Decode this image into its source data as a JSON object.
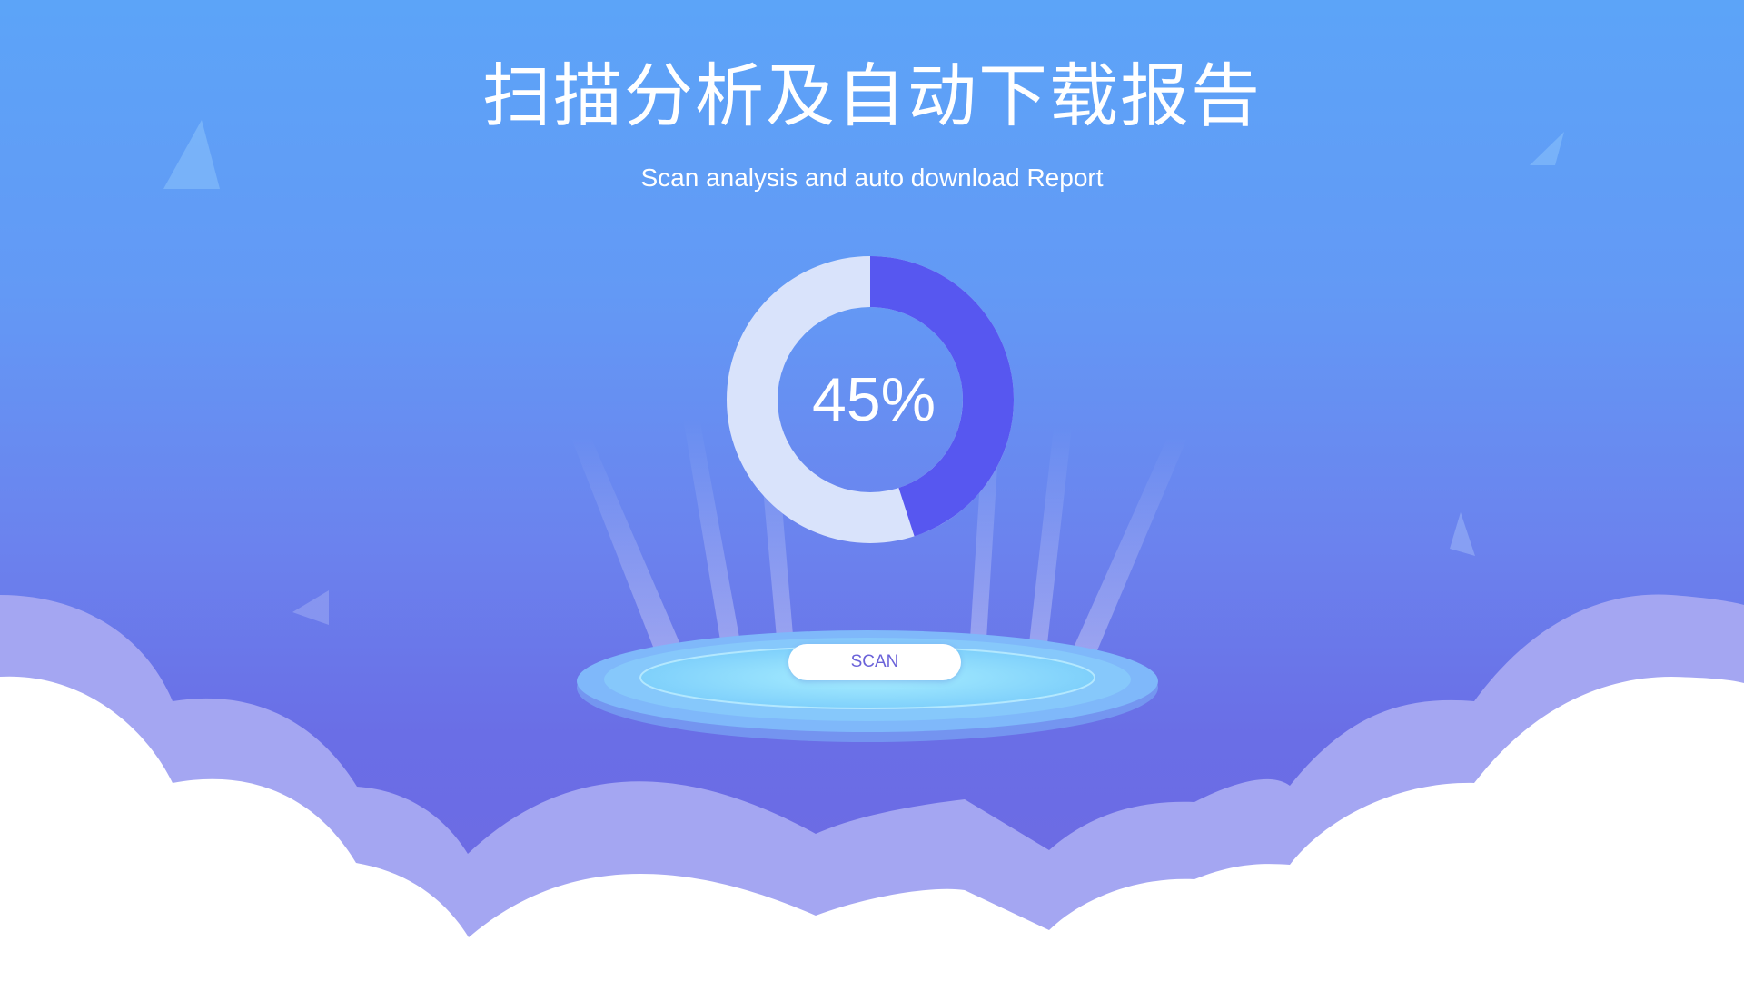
{
  "header": {
    "title": "扫描分析及自动下载报告",
    "subtitle": "Scan analysis and auto download Report"
  },
  "progress": {
    "value": 45,
    "label": "45%",
    "colors": {
      "filled": "#5757f0",
      "track": "#d9e3fb"
    }
  },
  "scan_button": {
    "label": "SCAN"
  },
  "colors": {
    "background_top": "#5ca4f8",
    "background_bottom": "#6e68e2",
    "cloud_back": "#a5a7f3",
    "cloud_front": "#ffffff",
    "platform": "#8fd9fb"
  }
}
